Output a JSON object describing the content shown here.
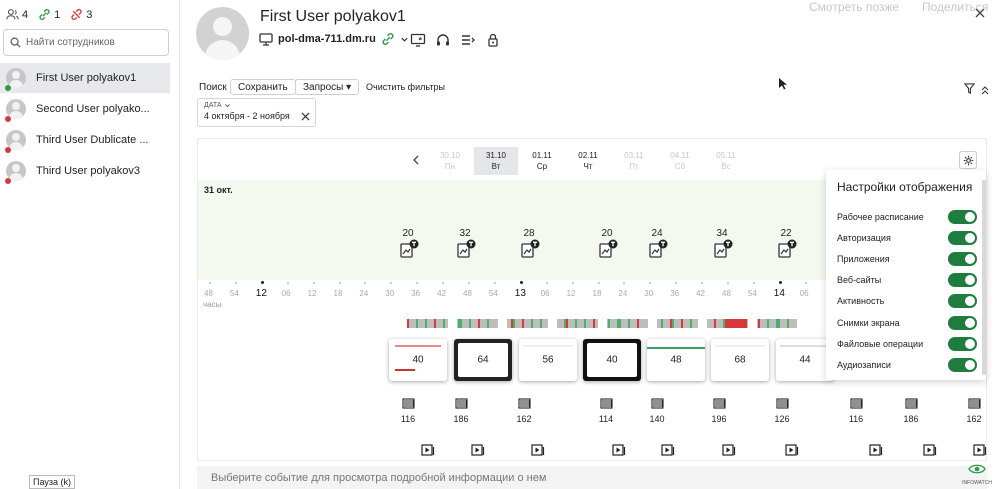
{
  "sidebar": {
    "counts": [
      "4",
      "1",
      "3"
    ],
    "search_placeholder": "Найти сотрудников",
    "users": [
      {
        "name": "First User polyakov1",
        "status": "green",
        "selected": true
      },
      {
        "name": "Second User polyako...",
        "status": "red",
        "selected": false
      },
      {
        "name": "Third User Dublicate ...",
        "status": "red",
        "selected": false
      },
      {
        "name": "Third User polyakov3",
        "status": "red",
        "selected": false
      }
    ]
  },
  "header": {
    "user_name": "First User polyakov1",
    "computer": "pol-dma-711.dm.ru",
    "watch_later": "Смотреть позже",
    "share": "Поделиться"
  },
  "filters": {
    "search_label": "Поиск",
    "save_label": "Сохранить",
    "queries_label": "Запросы ▾",
    "clear_label": "Очистить фильтры",
    "date_label": "ДАТА",
    "date_value": "4 октября - 2 ноября"
  },
  "timeline": {
    "days": [
      {
        "date": "30.10",
        "dow": "Пн"
      },
      {
        "date": "31.10",
        "dow": "Вт",
        "selected": true
      },
      {
        "date": "01.11",
        "dow": "Ср",
        "active": true
      },
      {
        "date": "02.11",
        "dow": "Чт",
        "active": true
      },
      {
        "date": "03.11",
        "dow": "Пт"
      },
      {
        "date": "04.11",
        "dow": "Сб"
      },
      {
        "date": "05.11",
        "dow": "Вс"
      }
    ],
    "day_label": "31 окт.",
    "hours_label": "часы",
    "hour_labels": [
      "48",
      "54",
      "12",
      "06",
      "12",
      "18",
      "24",
      "30",
      "36",
      "42",
      "48",
      "54",
      "13",
      "06",
      "12",
      "18",
      "24",
      "30",
      "36",
      "42",
      "48",
      "54",
      "14",
      "06"
    ],
    "app_counts": [
      "20",
      "32",
      "28",
      "20",
      "24",
      "34",
      "22"
    ],
    "screenshot_counts": [
      "40",
      "64",
      "56",
      "40",
      "48",
      "68",
      "44"
    ],
    "file_counts": [
      "116",
      "186",
      "162",
      "114",
      "140",
      "196",
      "126",
      "116",
      "186",
      "162"
    ]
  },
  "settings": {
    "title": "Настройки отображения",
    "items": [
      "Рабочее расписание",
      "Авторизация",
      "Приложения",
      "Веб-сайты",
      "Активность",
      "Снимки экрана",
      "Файловые операции",
      "Аудиозаписи"
    ]
  },
  "bottom_hint": "Выберите событие для просмотра подробной информации о нем",
  "tooltip": "Пауза (k)",
  "brand": "INFOWATCH",
  "colors": {
    "accent_green": "#1e7d3e",
    "status_green": "#2e9b4a",
    "status_red": "#d9383a"
  }
}
